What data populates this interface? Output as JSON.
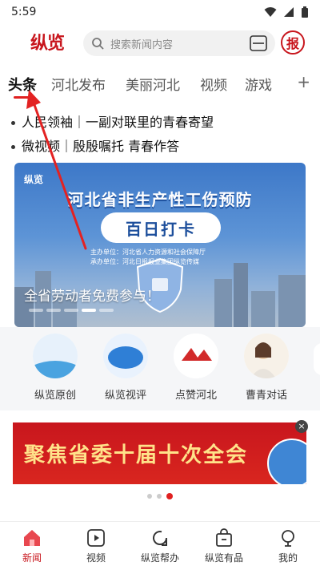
{
  "status_bar": {
    "time": "5:59"
  },
  "header": {
    "logo_text": "纵览",
    "search_placeholder": "搜索新闻内容",
    "bao_text": "报"
  },
  "tabs": {
    "items": [
      {
        "label": "头条",
        "active": true
      },
      {
        "label": "河北发布"
      },
      {
        "label": "美丽河北"
      },
      {
        "label": "视频"
      },
      {
        "label": "游戏"
      }
    ],
    "add_label": "+"
  },
  "headlines": [
    "人民领袖｜一副对联里的青春寄望",
    "微视频｜殷殷嘱托 青春作答"
  ],
  "banner": {
    "small_logo": "纵览",
    "title": "河北省非生产性工伤预防",
    "subtitle": "百日打卡",
    "line1": "主办单位：河北省人力资源和社会保障厅",
    "line2": "承办单位：河北日报报业集团纵览传媒",
    "caption": "全省劳动者免费参与！",
    "dot_count": 5,
    "active_dot": 3
  },
  "quick_links": [
    {
      "label": "纵览原创",
      "icon": "纵览原创-icon"
    },
    {
      "label": "纵览视评",
      "icon": "纵览视评-icon"
    },
    {
      "label": "点赞河北",
      "icon": "点赞河北-icon"
    },
    {
      "label": "曹青对话",
      "icon": "曹青对话-icon"
    }
  ],
  "ad": {
    "text": "聚焦省委十届十次全会",
    "close_label": "×",
    "dot_count": 3,
    "active_dot": 2
  },
  "bottom_nav": [
    {
      "label": "新闻",
      "icon": "home-icon",
      "active": true
    },
    {
      "label": "视频",
      "icon": "video-icon"
    },
    {
      "label": "纵览帮办",
      "icon": "help-icon"
    },
    {
      "label": "纵览有品",
      "icon": "shop-bag-icon"
    },
    {
      "label": "我的",
      "icon": "profile-icon"
    }
  ],
  "colors": {
    "accent": "#c8161d",
    "indicator": "#e02020",
    "banner_blue": "#3d78c8"
  }
}
